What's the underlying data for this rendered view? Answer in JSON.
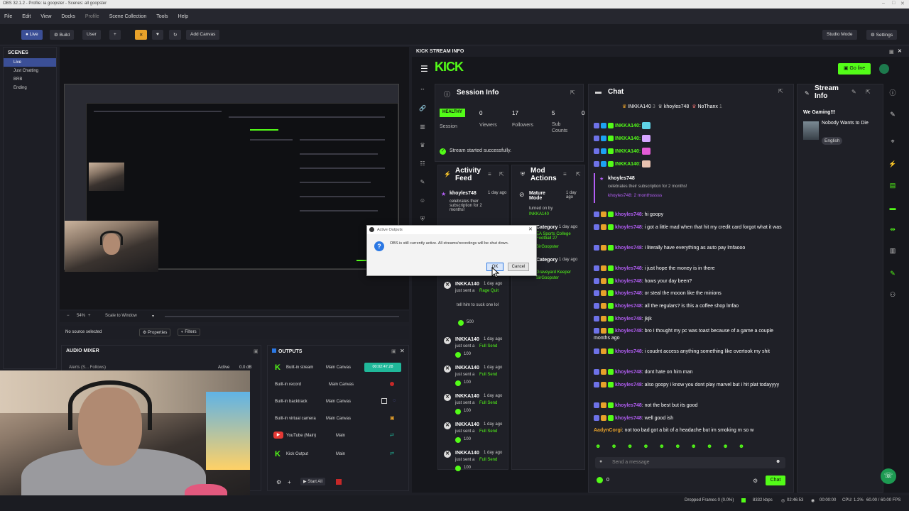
{
  "window": {
    "title": "OBS 32.1.2 - Profile: ia goopster - Scenes: all goopster"
  },
  "menu": [
    "File",
    "Edit",
    "View",
    "Docks",
    "Profile",
    "Scene Collection",
    "Tools",
    "Help"
  ],
  "toolbar": {
    "live": "Live",
    "build": "Build",
    "user": "User",
    "add": "+",
    "add_canvas": "Add Canvas",
    "studio_mode": "Studio Mode",
    "settings": "Settings"
  },
  "scenes": {
    "title": "SCENES",
    "items": [
      "Live",
      "Just Chatting",
      "BRB",
      "Ending"
    ]
  },
  "preview": {
    "zoom": "54%",
    "scale": "Scale to Window",
    "no_source": "No source selected",
    "properties": "Properties",
    "filters": "Filters"
  },
  "mixer": {
    "title": "AUDIO MIXER",
    "source": "Alerts (S... Follows)",
    "state": "Active",
    "level": "0.0 dB"
  },
  "outputs": {
    "title": "OUTPUTS",
    "rows": [
      {
        "name": "Built-in stream",
        "canvas": "Main Canvas",
        "status": "00:02:47.28"
      },
      {
        "name": "Built-in record",
        "canvas": "Main Canvas",
        "status": ""
      },
      {
        "name": "Built-in backtrack",
        "canvas": "Main Canvas",
        "status": ""
      },
      {
        "name": "Built-in virtual camera",
        "canvas": "Main Canvas",
        "status": ""
      },
      {
        "name": "YouTube (Main)",
        "canvas": "Main",
        "status": ""
      },
      {
        "name": "Kick Output",
        "canvas": "Main",
        "status": ""
      }
    ],
    "start_all": "Start All"
  },
  "kick": {
    "dock_title": "KICK STREAM INFO",
    "logo": "KICK",
    "go_live": "Go live",
    "session": {
      "title": "Session Info",
      "health": "HEALTHY",
      "session_label": "Session",
      "viewers": "0",
      "viewers_label": "Viewers",
      "followers": "17",
      "followers_label": "Followers",
      "subs": "5",
      "subs_label": "Sub Counts",
      "extra": "0",
      "started": "Stream started successfully."
    },
    "activity": {
      "title": "Activity Feed",
      "items": [
        {
          "user": "khoyles748",
          "time": "1 day ago",
          "text": "celebrates their subscription for 2 months!"
        },
        {
          "user": "INKKA140",
          "time": "1 day ago",
          "text": "just sent a",
          "item": "Rage Quit",
          "msg": "tell him to suck one lol",
          "amount": "500"
        },
        {
          "user": "INKKA140",
          "time": "1 day ago",
          "text": "just sent a",
          "item": "Full Send",
          "amount": "100"
        },
        {
          "user": "INKKA140",
          "time": "1 day ago",
          "text": "just sent a",
          "item": "Full Send",
          "amount": "100"
        },
        {
          "user": "INKKA140",
          "time": "1 day ago",
          "text": "just sent a",
          "item": "Full Send",
          "amount": "100"
        },
        {
          "user": "INKKA140",
          "time": "1 day ago",
          "text": "just sent a",
          "item": "Full Send",
          "amount": "100"
        },
        {
          "user": "INKKA140",
          "time": "1 day ago",
          "text": "just sent a",
          "item": "Full Send",
          "amount": "100"
        }
      ]
    },
    "mod": {
      "title": "Mod Actions",
      "items": [
        {
          "title": "Mature Mode",
          "time": "1 day ago",
          "text": "turned on by",
          "by": "INKKA140"
        },
        {
          "title": "Category",
          "time": "1 day ago",
          "text": "changed to",
          "value": "EA Sports College Football 27",
          "by": "SirGoopster"
        },
        {
          "title": "Category",
          "time": "1 day ago",
          "text": "changed to",
          "value": "Graveyard Keeper",
          "by": "SirGoopster"
        }
      ]
    },
    "chat": {
      "title": "Chat",
      "top": [
        {
          "name": "INKKA140",
          "n": "3"
        },
        {
          "name": "khoyles748",
          "n": ""
        },
        {
          "name": "NoThanx",
          "n": "1"
        }
      ],
      "emote_user": "INKKA140:",
      "sub_user": "khoyles748",
      "sub_text": "celebrates their subscription for 2 months!",
      "sub_msg": "khoyles748: 2 monthsssss",
      "messages": [
        {
          "user": "khoyles748",
          "text": ": hi goopy"
        },
        {
          "user": "khoyles748",
          "text": ": i got a little mad when that hit my credit card forgot what it was"
        },
        {
          "user": "khoyles748",
          "text": ": i literally have everything as auto pay lmfaooo"
        },
        {
          "user": "khoyles748",
          "text": ": i just hope the money is in there"
        },
        {
          "user": "khoyles748",
          "text": ": hows your day been?"
        },
        {
          "user": "khoyles748",
          "text": ": or steal the mooon like the minions"
        },
        {
          "user": "khoyles748",
          "text": ": all the regulars? is this a coffee shop lmfao"
        },
        {
          "user": "khoyles748",
          "text": ": jkjk"
        },
        {
          "user": "khoyles748",
          "text": ": bro I thought my pc was toast because of a game a couple months ago"
        },
        {
          "user": "khoyles748",
          "text": ": i coudnt access anything something like overtook my shit"
        },
        {
          "user": "khoyles748",
          "text": ": dont hate on him man"
        },
        {
          "user": "khoyles748",
          "text": ": also goopy i know you dont play marvel but i hit plat todayyyy"
        },
        {
          "user": "khoyles748",
          "text": ": not the best but its good"
        },
        {
          "user": "khoyles748",
          "text": ": well good ish"
        }
      ],
      "last_user": "AadynCorgi",
      "last_text": ": not too bad got a bit of a headache but im smoking rn so w",
      "placeholder": "Send a message",
      "count": "0",
      "send": "Chat"
    },
    "stream_info": {
      "title": "Stream Info",
      "stream_title": "We Gaming!!!",
      "game": "Nobody Wants to Die",
      "language": "English"
    }
  },
  "dialog": {
    "title": "Active Outputs",
    "message": "OBS is still currently active. All streams/recordings will be shut down.",
    "ok": "OK",
    "cancel": "Cancel"
  },
  "status": {
    "dropped": "Dropped Frames 0 (0.0%)",
    "bitrate": "8332 kbps",
    "stream_time": "02:46:53",
    "rec_time": "00:00:00",
    "cpu": "CPU: 1.2%",
    "fps": "60.00 / 60.00 FPS"
  }
}
